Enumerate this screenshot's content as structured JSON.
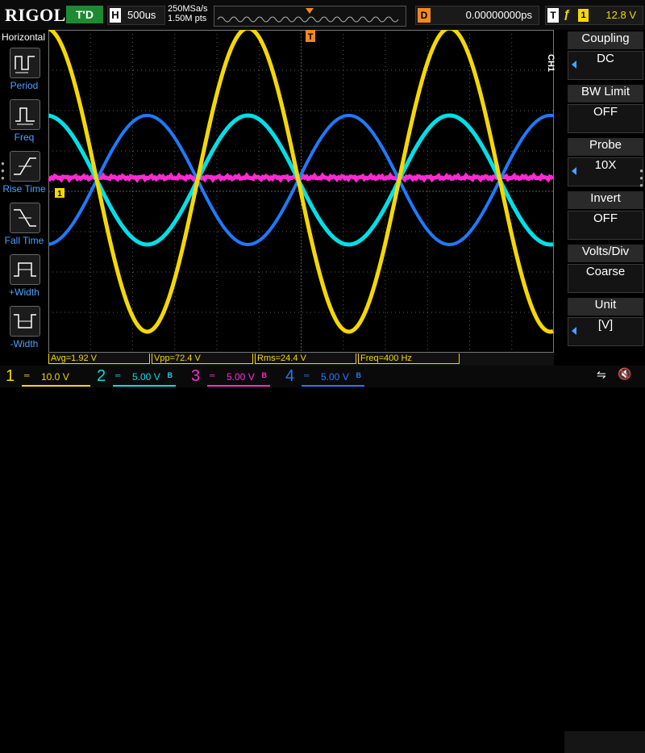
{
  "header": {
    "logo": "RIGOL",
    "run_state": "T'D",
    "timebase_tag": "H",
    "timebase": "500us",
    "sample_rate": "250MSa/s",
    "memory_depth": "1.50M pts",
    "delay_tag": "D",
    "delay": "0.00000000ps",
    "trigger_tag": "T",
    "trigger_channel": "1",
    "trigger_level": "12.8 V"
  },
  "left_menu": {
    "title": "Horizontal",
    "items": [
      {
        "label": "Period",
        "icon": "period-icon"
      },
      {
        "label": "Freq",
        "icon": "frequency-icon"
      },
      {
        "label": "Rise Time",
        "icon": "rise-time-icon"
      },
      {
        "label": "Fall Time",
        "icon": "fall-time-icon"
      },
      {
        "label": "+Width",
        "icon": "positive-width-icon"
      },
      {
        "label": "-Width",
        "icon": "negative-width-icon"
      }
    ]
  },
  "right_menu": {
    "channel_label": "CH1",
    "items": [
      {
        "title": "Coupling",
        "value": "DC",
        "has_arrow": true
      },
      {
        "title": "BW Limit",
        "value": "OFF",
        "has_arrow": false
      },
      {
        "title": "Probe",
        "value": "10X",
        "has_arrow": true
      },
      {
        "title": "Invert",
        "value": "OFF",
        "has_arrow": false
      },
      {
        "title": "Volts/Div",
        "value": "Coarse",
        "has_arrow": false
      },
      {
        "title": "Unit",
        "value": "[V]",
        "has_arrow": true
      }
    ]
  },
  "plot_markers": {
    "trigger_position": "T",
    "ch1_marker": "1"
  },
  "measurements": [
    {
      "label": "Avg=1.92 V"
    },
    {
      "label": "Vpp=72.4 V"
    },
    {
      "label": "Rms=24.4 V"
    },
    {
      "label": "Freq=400 Hz"
    }
  ],
  "channels": [
    {
      "num": "1",
      "scale": "10.0 V",
      "color": "#f5d800"
    },
    {
      "num": "2",
      "scale": "5.00 V",
      "color": "#00e0e8"
    },
    {
      "num": "3",
      "scale": "5.00 V",
      "color": "#ff2ad4"
    },
    {
      "num": "4",
      "scale": "5.00 V",
      "color": "#1e7bff"
    }
  ],
  "colors": {
    "ch1": "#f5d800",
    "ch2": "#00e0e8",
    "ch3": "#ff2ad4",
    "ch4": "#1e7bff",
    "menu_accent": "#4aa3ff",
    "delay": "#f08a1e",
    "run": "#1f8a32"
  }
}
